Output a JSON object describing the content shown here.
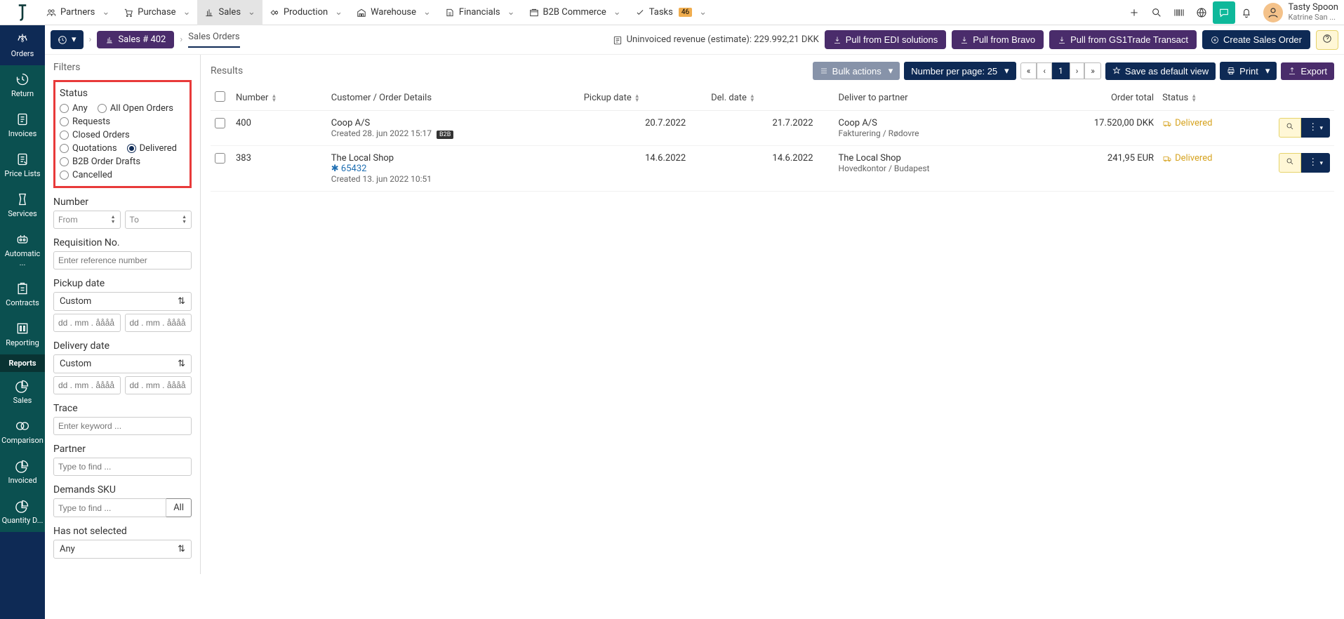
{
  "topnav": {
    "menus": [
      {
        "label": "Partners"
      },
      {
        "label": "Purchase"
      },
      {
        "label": "Sales",
        "active": true
      },
      {
        "label": "Production"
      },
      {
        "label": "Warehouse"
      },
      {
        "label": "Financials"
      },
      {
        "label": "B2B Commerce"
      },
      {
        "label": "Tasks",
        "badge": "46"
      }
    ],
    "user_name": "Tasty Spoon",
    "user_sub": "Katrine San ..."
  },
  "secbar": {
    "crumb_pill": "Sales # 402",
    "crumb_page": "Sales Orders",
    "revenue_label": "Uninvoiced revenue (estimate): 229.992,21 DKK",
    "btn_edi": "Pull from EDI solutions",
    "btn_bravo": "Pull from Bravo",
    "btn_gs1": "Pull from GS1Trade Transact",
    "btn_create": "Create Sales Order"
  },
  "leftnav": [
    {
      "label": "Orders",
      "active": true
    },
    {
      "label": "Return"
    },
    {
      "label": "Invoices"
    },
    {
      "label": "Price Lists"
    },
    {
      "label": "Services"
    },
    {
      "label": "Automatic ..."
    },
    {
      "label": "Contracts"
    },
    {
      "label": "Reporting"
    },
    {
      "label": "Reports",
      "section": true
    },
    {
      "label": "Sales"
    },
    {
      "label": "Comparison"
    },
    {
      "label": "Invoiced"
    },
    {
      "label": "Quantity D..."
    }
  ],
  "filters": {
    "title": "Filters",
    "status_label": "Status",
    "status_options": [
      "Any",
      "All Open Orders",
      "Requests",
      "Closed Orders",
      "Quotations",
      "Delivered",
      "B2B Order Drafts",
      "Cancelled"
    ],
    "status_selected": "Delivered",
    "number_label": "Number",
    "number_from_ph": "From",
    "number_to_ph": "To",
    "req_label": "Requisition No.",
    "req_ph": "Enter reference number",
    "pickup_label": "Pickup date",
    "pickup_select": "Custom",
    "date_ph": "dd . mm . åååå",
    "delivery_label": "Delivery date",
    "delivery_select": "Custom",
    "trace_label": "Trace",
    "trace_ph": "Enter keyword ...",
    "partner_label": "Partner",
    "partner_ph": "Type to find ...",
    "sku_label": "Demands SKU",
    "sku_ph": "Type to find ...",
    "sku_all": "All",
    "hasnot_label": "Has not selected",
    "hasnot_select": "Any"
  },
  "results": {
    "title": "Results",
    "bulk": "Bulk actions",
    "perpage": "Number per page: 25",
    "pager": [
      "«",
      "‹",
      "1",
      "›",
      "»"
    ],
    "pager_active": "1",
    "save_view": "Save as default view",
    "print": "Print",
    "export": "Export",
    "cols": [
      "",
      "Number",
      "Customer / Order Details",
      "Pickup date",
      "Del. date",
      "Deliver to partner",
      "Order total",
      "Status",
      ""
    ],
    "rows": [
      {
        "number": "400",
        "cust": "Coop A/S",
        "cust_created": "Created 28. jun 2022 15:17",
        "cust_badge": "B2B",
        "pickup": "20.7.2022",
        "del": "21.7.2022",
        "deliver": "Coop A/S",
        "deliver_sub": "Fakturering / Rødovre",
        "total": "17.520,00 DKK",
        "status": "Delivered"
      },
      {
        "number": "383",
        "cust": "The Local Shop",
        "cust_link": "65432",
        "cust_created": "Created 13. jun 2022 10:51",
        "pickup": "14.6.2022",
        "del": "14.6.2022",
        "deliver": "The Local Shop",
        "deliver_sub": "Hovedkontor / Budapest",
        "total": "241,95 EUR",
        "status": "Delivered"
      }
    ]
  }
}
